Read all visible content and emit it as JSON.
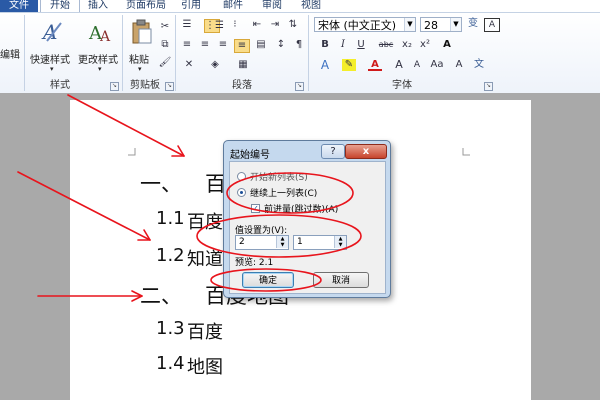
{
  "tabs": {
    "file": "文件",
    "home": "开始",
    "insert": "插入",
    "layout": "页面布局",
    "references": "引用",
    "mailings": "邮件",
    "review": "审阅",
    "view": "视图"
  },
  "ribbon": {
    "edit_label": "编辑",
    "quick_styles": "快速样式",
    "change_styles": "更改样式",
    "paste": "粘贴",
    "groups": {
      "styles": "样式",
      "clipboard": "剪贴板",
      "paragraph": "段落",
      "font": "字体"
    },
    "font_name": "宋体 (中文正文)",
    "font_size": "28",
    "bold": "B",
    "italic": "I",
    "underline": "U",
    "strike": "abc",
    "subscript": "x₂",
    "superscript": "x²",
    "char_shade": "A",
    "enlarge": "A",
    "shrink": "A",
    "format_a": "Aa",
    "clear_a": "A",
    "wen": "变",
    "wen2": "A",
    "phonetic": "文"
  },
  "document": {
    "heading1_num": "一、",
    "heading1_text": "百",
    "item11_num": "1.1",
    "item11_text": "百度",
    "item12_num": "1.2",
    "item12_text": "知道",
    "heading2_num": "二、",
    "heading2_text": "百度地图",
    "item13_num": "1.3",
    "item13_text": "百度",
    "item14_num": "1.4",
    "item14_text": "地图"
  },
  "dialog": {
    "title": "起始编号",
    "help": "?",
    "close": "x",
    "option_new_list": "开始新列表(S)",
    "option_continue": "继续上一列表(C)",
    "option_advance": "前进量(跳过数)(A)",
    "value_label": "值设置为(V):",
    "level_value": "2",
    "number_value": "1",
    "preview": "预览: 2.1",
    "ok": "确定",
    "cancel": "取消",
    "selected_option": "继续上一列表(C)",
    "advance_checked": true
  },
  "colors": {
    "file_tab": "#2a5aa6",
    "annotation": "#e8141c",
    "dialog_frame": "#c5d9ee"
  }
}
